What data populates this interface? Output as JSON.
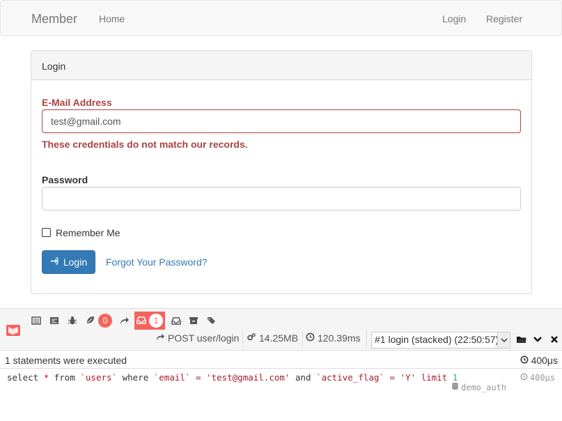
{
  "navbar": {
    "brand": "Member",
    "home": "Home",
    "login": "Login",
    "register": "Register"
  },
  "panel": {
    "heading": "Login",
    "email_label": "E-Mail Address",
    "email_value": "test@gmail.com",
    "email_error": "These credentials do not match our records.",
    "password_label": "Password",
    "password_value": "",
    "remember_label": "Remember Me",
    "login_button": "Login",
    "forgot_link": "Forgot Your Password?"
  },
  "debugbar": {
    "exceptions_count": "0",
    "queries_count": "1",
    "request": "POST user/login",
    "memory": "14.25MB",
    "time": "120.39ms",
    "dataset": "#1 login (stacked) (22:50:57)",
    "status_text": "1 statements were executed",
    "status_time": "400μs",
    "query_time": "400μs",
    "query_connection": "demo_auth",
    "sql": {
      "t1": "select ",
      "t2": "*",
      "t3": " from ",
      "t4": "`users`",
      "t5": " where ",
      "t6": "`email`",
      "t7": " = ",
      "t8": "'test@gmail.com'",
      "t9": " and ",
      "t10": "`active_flag`",
      "t11": " = ",
      "t12": "'Y'",
      "t13": " limit ",
      "t14": "1"
    }
  },
  "colors": {
    "primary": "#337ab7",
    "error": "#a94442",
    "debug_accent": "#f4645f"
  }
}
